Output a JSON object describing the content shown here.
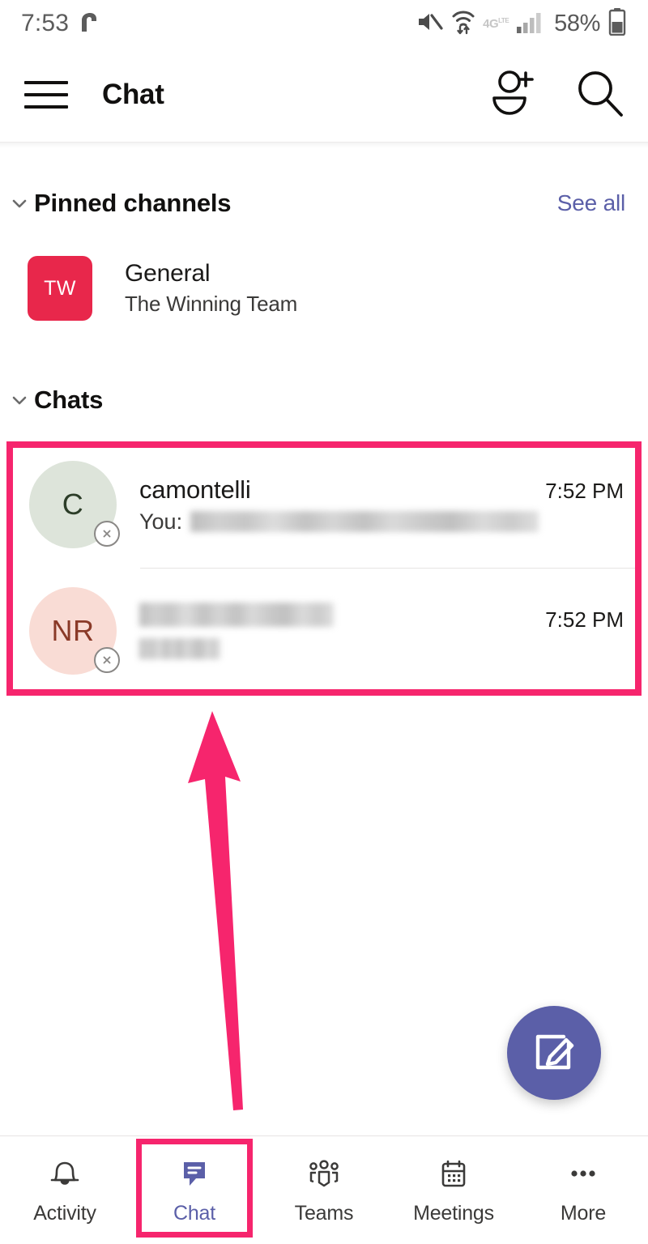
{
  "status_bar": {
    "time": "7:53",
    "app_glyph_icon": "nova-launcher-icon",
    "mute_icon": "speaker-mute-icon",
    "wifi_icon": "wifi-data-transfer-icon",
    "network_label": "4G",
    "network_sublabel": "LTE",
    "signal_icon": "cellular-signal-icon",
    "battery_percent": "58%",
    "battery_icon": "battery-half-icon"
  },
  "header": {
    "menu_icon": "hamburger-menu-icon",
    "title": "Chat",
    "add_person_icon": "add-person-icon",
    "search_icon": "search-icon"
  },
  "pinned_channels": {
    "section_title": "Pinned channels",
    "collapse_icon": "chevron-down-icon",
    "see_all_label": "See all",
    "see_all_color": "#5b5fa8",
    "items": [
      {
        "avatar_initials": "TW",
        "avatar_color": "#e8274b",
        "name": "General",
        "team": "The Winning Team"
      }
    ]
  },
  "chats": {
    "section_title": "Chats",
    "collapse_icon": "chevron-down-icon",
    "items": [
      {
        "avatar_initials": "C",
        "avatar_bg": "#dde4da",
        "avatar_fg": "#2c3d28",
        "presence_icon": "presence-offline-icon",
        "name": "camontelli",
        "name_redacted": false,
        "preview_prefix": "You:",
        "preview_redacted": true,
        "time": "7:52 PM"
      },
      {
        "avatar_initials": "NR",
        "avatar_bg": "#f9dcd5",
        "avatar_fg": "#8a3a28",
        "presence_icon": "presence-offline-icon",
        "name": "",
        "name_redacted": true,
        "preview_prefix": "",
        "preview_redacted": true,
        "time": "7:52 PM"
      }
    ]
  },
  "compose_fab": {
    "icon": "compose-new-chat-icon",
    "color": "#5b5fa8"
  },
  "bottom_nav": {
    "items": [
      {
        "label": "Activity",
        "icon": "bell-icon",
        "active": false
      },
      {
        "label": "Chat",
        "icon": "chat-bubble-icon",
        "active": true
      },
      {
        "label": "Teams",
        "icon": "teams-people-icon",
        "active": false
      },
      {
        "label": "Meetings",
        "icon": "calendar-icon",
        "active": false
      },
      {
        "label": "More",
        "icon": "ellipsis-icon",
        "active": false
      }
    ],
    "active_color": "#5b5fa8",
    "inactive_color": "#3b3a39"
  },
  "annotations": {
    "highlight_color": "#f6256d",
    "arrow_icon": "up-arrow-annotation",
    "chat_list_highlight": "chat-list-highlight-box",
    "chat_tab_highlight": "chat-tab-highlight-box"
  }
}
